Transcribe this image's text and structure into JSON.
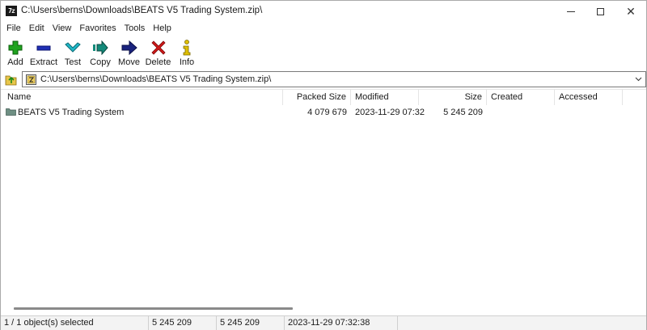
{
  "window": {
    "title": "C:\\Users\\berns\\Downloads\\BEATS V5 Trading System.zip\\",
    "app_icon_text": "7z"
  },
  "menu": [
    "File",
    "Edit",
    "View",
    "Favorites",
    "Tools",
    "Help"
  ],
  "toolbar": {
    "add": "Add",
    "extract": "Extract",
    "test": "Test",
    "copy": "Copy",
    "move": "Move",
    "delete": "Delete",
    "info": "Info"
  },
  "address": {
    "path": "C:\\Users\\berns\\Downloads\\BEATS V5 Trading System.zip\\"
  },
  "columns": {
    "name": "Name",
    "packed_size": "Packed Size",
    "modified": "Modified",
    "size": "Size",
    "created": "Created",
    "accessed": "Accessed"
  },
  "rows": [
    {
      "name": "BEATS V5 Trading System",
      "packed_size": "4 079 679",
      "modified": "2023-11-29 07:32",
      "size": "5 245 209",
      "created": "",
      "accessed": ""
    }
  ],
  "status": {
    "selection": "1 / 1 object(s) selected",
    "size": "5 245 209",
    "packed": "5 245 209",
    "modified": "2023-11-29 07:32:38"
  },
  "colors": {
    "folder": "#6e8f83",
    "add_green": "#1fa31f",
    "extract_blue": "#1f2fb5",
    "test_cyan": "#20b8c8",
    "copy_teal": "#138a7a",
    "move_navy": "#1a237e",
    "delete_red": "#d01818",
    "info_yellow": "#e0c000"
  }
}
